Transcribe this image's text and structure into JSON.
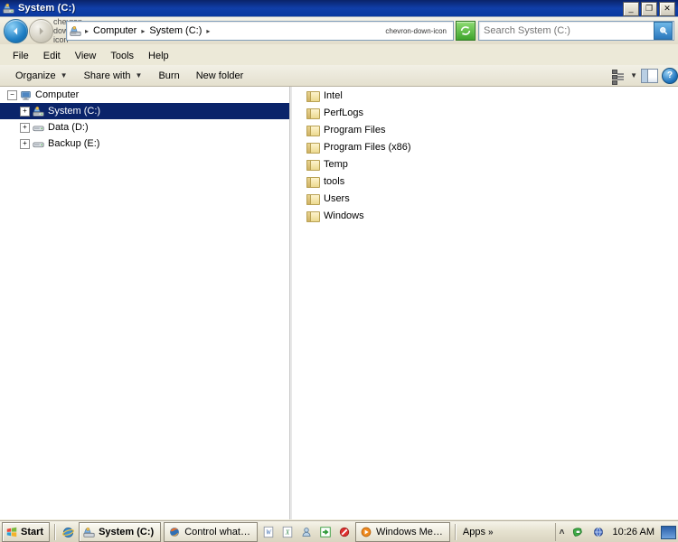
{
  "window": {
    "title": "System (C:)",
    "title_icon": "drive-icon",
    "controls": {
      "minimize": "_",
      "maximize": "❐",
      "close": "✕"
    }
  },
  "address_bar": {
    "back_icon": "back-arrow-icon",
    "forward_icon": "forward-arrow-icon",
    "history_chevron": "chevron-down-icon",
    "computer_icon": "computer-icon",
    "breadcrumbs": [
      "Computer",
      "System (C:)"
    ],
    "separator": "▸",
    "dropdown_icon": "chevron-down-icon",
    "refresh_icon": "refresh-icon",
    "search_placeholder": "Search System (C:)",
    "search_value": "",
    "search_icon": "magnifier-icon"
  },
  "menu": {
    "items": [
      "File",
      "Edit",
      "View",
      "Tools",
      "Help"
    ]
  },
  "toolbar": {
    "organize_label": "Organize",
    "share_label": "Share with",
    "burn_label": "Burn",
    "new_folder_label": "New folder",
    "caret": "▼",
    "view_icon": "view-layout-icon",
    "view_caret": "▼",
    "preview_pane_icon": "preview-pane-icon",
    "help_icon": "help-icon",
    "help_glyph": "?"
  },
  "tree": {
    "nodes": [
      {
        "label": "Computer",
        "icon": "computer-icon",
        "expander": "−",
        "indent": 0,
        "selected": false
      },
      {
        "label": "System (C:)",
        "icon": "drive-icon",
        "expander": "+",
        "indent": 1,
        "selected": true
      },
      {
        "label": "Data (D:)",
        "icon": "disk-icon",
        "expander": "+",
        "indent": 1,
        "selected": false
      },
      {
        "label": "Backup (E:)",
        "icon": "disk-icon",
        "expander": "+",
        "indent": 1,
        "selected": false
      }
    ]
  },
  "file_list": {
    "items": [
      {
        "name": "Intel",
        "icon": "folder-icon"
      },
      {
        "name": "PerfLogs",
        "icon": "folder-icon"
      },
      {
        "name": "Program Files",
        "icon": "folder-icon"
      },
      {
        "name": "Program Files (x86)",
        "icon": "folder-icon"
      },
      {
        "name": "Temp",
        "icon": "folder-icon"
      },
      {
        "name": "tools",
        "icon": "folder-icon"
      },
      {
        "name": "Users",
        "icon": "folder-icon"
      },
      {
        "name": "Windows",
        "icon": "folder-icon"
      }
    ]
  },
  "taskbar": {
    "start_label": "Start",
    "start_icon": "windows-logo-icon",
    "quick_launch": [
      {
        "icon": "internet-explorer-icon"
      }
    ],
    "tasks": [
      {
        "label": "System (C:)",
        "icon": "drive-icon",
        "active": true
      },
      {
        "label": "Control what…",
        "icon": "firefox-icon",
        "active": false
      }
    ],
    "tray_buttons": [
      {
        "icon": "word-icon",
        "glyph": "W"
      },
      {
        "icon": "excel-icon",
        "glyph": "X"
      },
      {
        "icon": "person-search-icon",
        "glyph": ""
      },
      {
        "icon": "green-arrow-icon",
        "glyph": "→"
      },
      {
        "icon": "block-icon",
        "glyph": "⃠"
      }
    ],
    "media_task": {
      "label": "Windows Me…",
      "icon": "media-player-icon"
    },
    "apps_label": "Apps",
    "apps_overflow": "»",
    "tray_chevron": "˄",
    "tray_icons": [
      {
        "icon": "green-shield-icon"
      },
      {
        "icon": "blue-globe-icon"
      }
    ],
    "clock": "10:26 AM",
    "show_desktop_icon": "show-desktop-icon"
  },
  "colors": {
    "titlebar": "#0a246a",
    "selection": "#0a246a",
    "chrome": "#ece9d8",
    "pane_bg": "#ffffff",
    "folder": "#ecd98f"
  }
}
